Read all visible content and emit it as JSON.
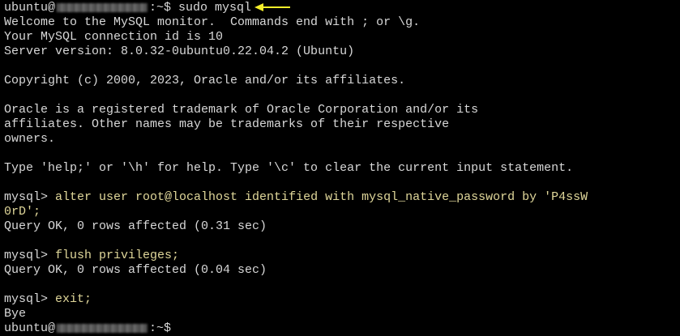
{
  "terminal": {
    "host_user": "ubuntu@",
    "prompt_suffix": ":~$",
    "first_command": " sudo mysql",
    "welcome": "Welcome to the MySQL monitor.  Commands end with ; or \\g.",
    "connection": "Your MySQL connection id is 10",
    "server_version": "Server version: 8.0.32-0ubuntu0.22.04.2 (Ubuntu)",
    "copyright": "Copyright (c) 2000, 2023, Oracle and/or its affiliates.",
    "trademark_1": "Oracle is a registered trademark of Oracle Corporation and/or its",
    "trademark_2": "affiliates. Other names may be trademarks of their respective",
    "trademark_3": "owners.",
    "help": "Type 'help;' or '\\h' for help. Type '\\c' to clear the current input statement.",
    "mysql_prompt": "mysql> ",
    "cmd_alter_1": "alter user root@localhost identified with mysql_native_password by 'P4ssW",
    "cmd_alter_2": "0rD';",
    "result_alter": "Query OK, 0 rows affected (0.31 sec)",
    "cmd_flush": "flush privileges;",
    "result_flush": "Query OK, 0 rows affected (0.04 sec)",
    "cmd_exit": "exit;",
    "bye": "Bye"
  },
  "colors": {
    "background": "#000000",
    "text": "#d8d8d8",
    "command": "#e0d79a",
    "arrow": "#f5ef2a"
  },
  "icons": {
    "annotation": "arrow-left-icon"
  }
}
